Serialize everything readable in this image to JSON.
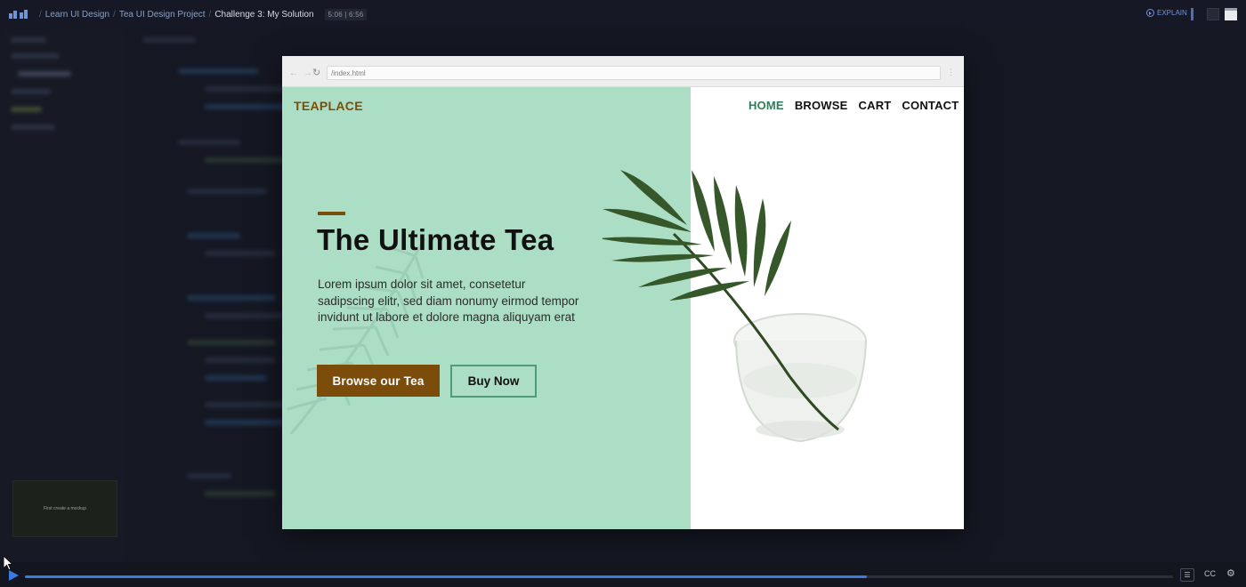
{
  "topbar": {
    "breadcrumbs": [
      "Learn UI Design",
      "Tea UI Design Project",
      "Challenge 3: My Solution"
    ],
    "time": "5:06 | 6:56",
    "explain_label": "EXPLAIN"
  },
  "thumbnail": {
    "caption": "First create a mockup"
  },
  "browser": {
    "url": "/index.html",
    "brand": "TEAPLACE",
    "nav": [
      "HOME",
      "BROWSE",
      "CART",
      "CONTACT"
    ],
    "headline": "The Ultimate Tea",
    "paragraph": "Lorem ipsum dolor sit amet, consetetur sadipscing elitr, sed diam nonumy eirmod tempor invidunt ut labore et dolore magna aliquyam erat",
    "primary_button": "Browse our Tea",
    "secondary_button": "Buy Now",
    "colors": {
      "hero_bg": "#abdec4",
      "brand": "#7c4c0b",
      "nav_active": "#2e7d5b",
      "outline": "#4f9a78"
    }
  },
  "player": {
    "progress": 0.733,
    "cc_label": "CC",
    "icons": [
      "play-icon",
      "transcript-icon",
      "settings-icon"
    ]
  }
}
